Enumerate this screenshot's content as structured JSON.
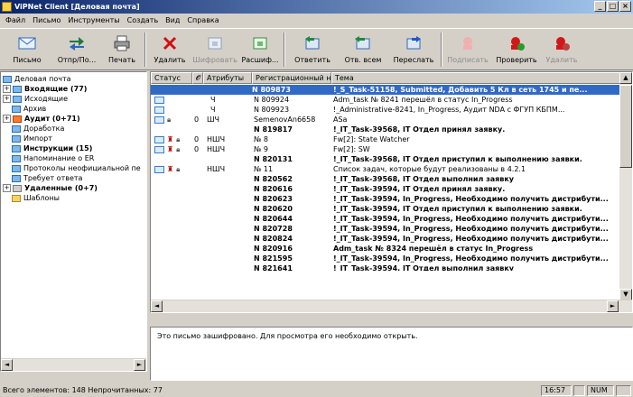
{
  "window": {
    "title": "ViPNet Client [Деловая почта]",
    "minimize": "_",
    "maximize": "□",
    "close": "×"
  },
  "menu": [
    "Файл",
    "Письмо",
    "Инструменты",
    "Создать",
    "Вид",
    "Справка"
  ],
  "toolbar": [
    {
      "label": "Письмо",
      "icon": "envelope-icon",
      "disabled": false
    },
    {
      "label": "Отпр/По...",
      "icon": "send-receive-icon",
      "disabled": false
    },
    {
      "label": "Печать",
      "icon": "printer-icon",
      "disabled": false
    },
    {
      "label": "Удалить",
      "icon": "delete-x-icon",
      "disabled": false
    },
    {
      "label": "Шифровать",
      "icon": "encrypt-icon",
      "disabled": true
    },
    {
      "label": "Расшиф...",
      "icon": "decrypt-icon",
      "disabled": false
    },
    {
      "label": "Ответить",
      "icon": "reply-icon",
      "disabled": false
    },
    {
      "label": "Отв. всем",
      "icon": "reply-all-icon",
      "disabled": false
    },
    {
      "label": "Переслать",
      "icon": "forward-icon",
      "disabled": false
    },
    {
      "label": "Подписать",
      "icon": "sign-icon",
      "disabled": true
    },
    {
      "label": "Проверить",
      "icon": "verify-icon",
      "disabled": false
    },
    {
      "label": "Удалить",
      "icon": "delete-signature-icon",
      "disabled": true
    }
  ],
  "tree": [
    {
      "label": "Деловая почта",
      "bold": false,
      "folder": "blue"
    },
    {
      "label": "Входящие (77)",
      "bold": true,
      "folder": "blue",
      "plus": "+"
    },
    {
      "label": "Исходящие",
      "bold": false,
      "folder": "blue",
      "plus": "+"
    },
    {
      "label": "Архив",
      "bold": false,
      "folder": "blue"
    },
    {
      "label": "Аудит (0+71)",
      "bold": true,
      "folder": "red",
      "plus": "+"
    },
    {
      "label": "Доработка",
      "bold": false,
      "folder": "blue"
    },
    {
      "label": "Импорт",
      "bold": false,
      "folder": "blue"
    },
    {
      "label": "Инструкции (15)",
      "bold": true,
      "folder": "blue"
    },
    {
      "label": "Напоминание о ER",
      "bold": false,
      "folder": "blue"
    },
    {
      "label": "Протоколы неофициальной пе",
      "bold": false,
      "folder": "blue"
    },
    {
      "label": "Требует ответа",
      "bold": false,
      "folder": "blue"
    },
    {
      "label": "Удаленные (0+7)",
      "bold": true,
      "folder": "gray",
      "plus": "+"
    },
    {
      "label": "Шаблоны",
      "bold": false,
      "folder": "yellow"
    }
  ],
  "columns": [
    "Статус",
    "",
    "Атрибуты",
    "Регистрационный номер",
    "Тема"
  ],
  "rows": [
    {
      "status": "",
      "attr": "",
      "reg": "N 809873",
      "subject": "!_S_Task-51158, Submitted, Добавить 5 Кл в сеть 1745 и пе...",
      "unread": true,
      "selected": true
    },
    {
      "status": "env",
      "attr": "Ч",
      "reg": "N 809924",
      "subject": "Adm_task № 8241 перешёл в статус In_Progress",
      "unread": false
    },
    {
      "status": "env",
      "attr": "Ч",
      "reg": "N 809923",
      "subject": "!_Administrative-8241, In_Progress, Аудит NDA с ФГУП КБПМ...",
      "unread": false
    },
    {
      "status": "env-lock-clip",
      "attr": "ШЧ",
      "reg": "SemenovAn6658",
      "subject": "ASa",
      "unread": false
    },
    {
      "status": "",
      "attr": "",
      "reg": "N 819817",
      "subject": "!_IT_Task-39568, IT Отдел принял заявку.",
      "unread": true
    },
    {
      "status": "env-red-lock-clip",
      "attr": "НШЧ",
      "reg": "№ 8",
      "subject": "Fw[2]: State Watcher",
      "unread": false
    },
    {
      "status": "env-red-lock-clip",
      "attr": "НШЧ",
      "reg": "№ 9",
      "subject": "Fw[2]: SW",
      "unread": false
    },
    {
      "status": "",
      "attr": "",
      "reg": "N 820131",
      "subject": "!_IT_Task-39568, IT Отдел приступил к выполнению заявки.",
      "unread": true
    },
    {
      "status": "env-red-lock",
      "attr": "НШЧ",
      "reg": "№ 11",
      "subject": "Список задач, которые будут реализованы в 4.2.1",
      "unread": false
    },
    {
      "status": "",
      "attr": "",
      "reg": "N 820562",
      "subject": "!_IT_Task-39568, IT Отдел выполнил заявку",
      "unread": true
    },
    {
      "status": "",
      "attr": "",
      "reg": "N 820616",
      "subject": "!_IT_Task-39594, IT Отдел принял заявку.",
      "unread": true
    },
    {
      "status": "",
      "attr": "",
      "reg": "N 820623",
      "subject": "!_IT_Task-39594, In_Progress, Необходимо получить дистрибути...",
      "unread": true
    },
    {
      "status": "",
      "attr": "",
      "reg": "N 820620",
      "subject": "!_IT_Task-39594, IT Отдел приступил к выполнению заявки.",
      "unread": true
    },
    {
      "status": "",
      "attr": "",
      "reg": "N 820644",
      "subject": "!_IT_Task-39594, In_Progress, Необходимо получить дистрибути...",
      "unread": true
    },
    {
      "status": "",
      "attr": "",
      "reg": "N 820728",
      "subject": "!_IT_Task-39594, In_Progress, Необходимо получить дистрибути...",
      "unread": true
    },
    {
      "status": "",
      "attr": "",
      "reg": "N 820824",
      "subject": "!_IT_Task-39594, In_Progress, Необходимо получить дистрибути...",
      "unread": true
    },
    {
      "status": "",
      "attr": "",
      "reg": "N 820916",
      "subject": "Adm_task № 8324 перешёл в статус In_Progress",
      "unread": true
    },
    {
      "status": "",
      "attr": "",
      "reg": "N 821595",
      "subject": "!_IT_Task-39594, In_Progress, Необходимо получить дистрибути...",
      "unread": true
    },
    {
      "status": "",
      "attr": "",
      "reg": "N 821641",
      "subject": "!_IT_Task-39594, IT Отдел выполнил заявку",
      "unread": true
    }
  ],
  "preview": {
    "text": "Это письмо зашифровано. Для просмотра его необходимо открыть."
  },
  "status": {
    "left": "Всего элементов: 148 Непрочитанных: 77",
    "time": "16:57",
    "num": "NUM"
  }
}
